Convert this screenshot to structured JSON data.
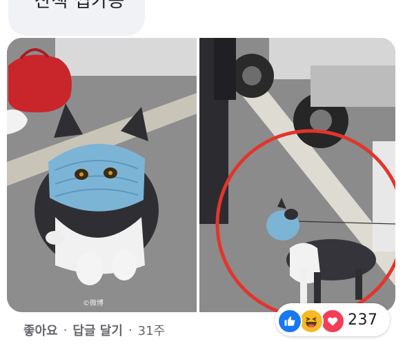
{
  "comment": {
    "text": "산책 씹가능"
  },
  "footer": {
    "like_label": "좋아요",
    "reply_label": "답글 달기",
    "separator": "·",
    "time_ago": "31주"
  },
  "reactions": {
    "types": [
      "like",
      "haha",
      "love"
    ],
    "count": "237",
    "colors": {
      "like": "#1877f2",
      "haha": "#f7b928",
      "love": "#f33e58"
    }
  },
  "image": {
    "watermark": "©微博"
  }
}
